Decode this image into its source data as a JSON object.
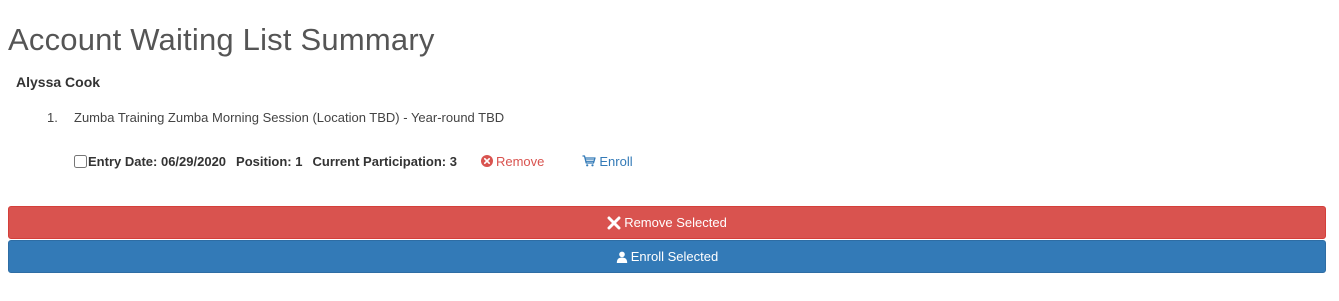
{
  "page": {
    "title": "Account Waiting List Summary",
    "account_name": "Alyssa Cook"
  },
  "waiting_list": {
    "items": [
      {
        "number": "1.",
        "title": "Zumba Training Zumba Morning Session (Location TBD) - Year-round TBD",
        "entry_date": "Entry Date: 06/29/2020",
        "position": "Position: 1",
        "current_participation": "Current Participation: 3",
        "checked": false,
        "remove_label": "Remove",
        "enroll_label": "Enroll"
      }
    ]
  },
  "actions": {
    "remove_selected_label": "Remove Selected",
    "enroll_selected_label": "Enroll Selected"
  },
  "colors": {
    "danger": "#d9534f",
    "primary": "#337ab7",
    "title_text": "#555555"
  },
  "icons": {
    "remove_link": "times-circle-icon",
    "enroll_link": "cart-icon",
    "remove_selected": "times-icon",
    "enroll_selected": "user-icon"
  }
}
